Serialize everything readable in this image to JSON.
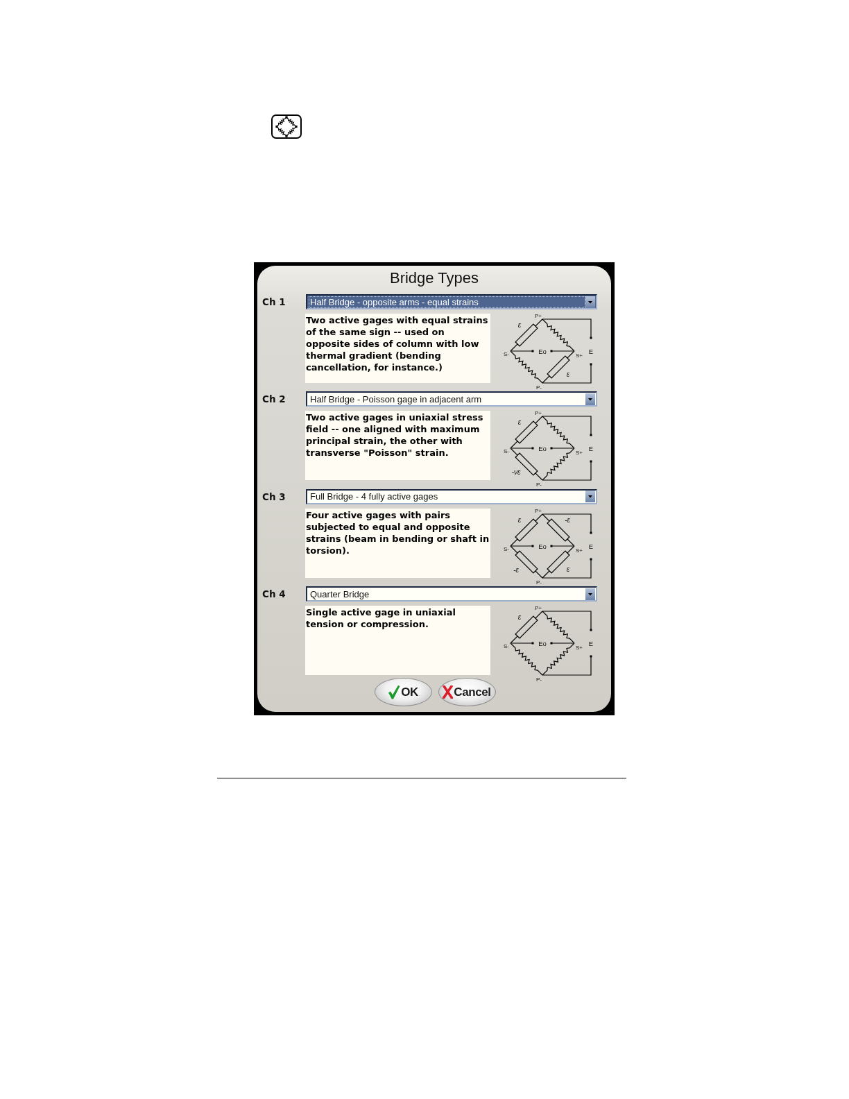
{
  "dialog": {
    "title": "Bridge Types",
    "channels": [
      {
        "label": "Ch 1",
        "bridge_type": "Half Bridge - opposite arms - equal strains",
        "focused": true,
        "description": "Two active gages with equal strains of the same sign -- used on opposite sides of column with low thermal gradient (bending cancellation, for instance.)",
        "diagram": {
          "terminals": {
            "top": "P+",
            "left": "S-",
            "right": "S+",
            "bottom": "P-",
            "output": "Eo",
            "excitation": "E"
          },
          "arms": {
            "upper_left": {
              "kind": "gage",
              "label": "ε"
            },
            "upper_right": {
              "kind": "resistor"
            },
            "lower_left": {
              "kind": "resistor"
            },
            "lower_right": {
              "kind": "gage",
              "label": "ε"
            }
          }
        }
      },
      {
        "label": "Ch 2",
        "bridge_type": "Half Bridge - Poisson gage in adjacent arm",
        "focused": false,
        "description": "Two active gages in uniaxial stress field -- one aligned with maximum principal strain, the other with transverse \"Poisson\" strain.",
        "diagram": {
          "terminals": {
            "top": "P+",
            "left": "S-",
            "right": "S+",
            "bottom": "P-",
            "output": "Eo",
            "excitation": "E"
          },
          "arms": {
            "upper_left": {
              "kind": "gage",
              "label": "ε"
            },
            "upper_right": {
              "kind": "resistor"
            },
            "lower_left": {
              "kind": "gage",
              "label": "-νε"
            },
            "lower_right": {
              "kind": "resistor"
            }
          }
        }
      },
      {
        "label": "Ch 3",
        "bridge_type": "Full Bridge - 4 fully active gages",
        "focused": false,
        "description": "Four active gages with pairs subjected to equal and opposite strains (beam in bending or shaft in torsion).",
        "diagram": {
          "terminals": {
            "top": "P+",
            "left": "S-",
            "right": "S+",
            "bottom": "P-",
            "output": "Eo",
            "excitation": "E"
          },
          "arms": {
            "upper_left": {
              "kind": "gage",
              "label": "ε"
            },
            "upper_right": {
              "kind": "gage",
              "label": "-ε"
            },
            "lower_left": {
              "kind": "gage",
              "label": "-ε"
            },
            "lower_right": {
              "kind": "gage",
              "label": "ε"
            }
          }
        }
      },
      {
        "label": "Ch 4",
        "bridge_type": "Quarter Bridge",
        "focused": false,
        "description": "Single active gage in uniaxial tension or compression.",
        "diagram": {
          "terminals": {
            "top": "P+",
            "left": "S-",
            "right": "S+",
            "bottom": "P-",
            "output": "Eo",
            "excitation": "E"
          },
          "arms": {
            "upper_left": {
              "kind": "gage",
              "label": "ε"
            },
            "upper_right": {
              "kind": "resistor"
            },
            "lower_left": {
              "kind": "resistor"
            },
            "lower_right": {
              "kind": "resistor"
            }
          }
        }
      }
    ],
    "buttons": [
      {
        "kind": "ok",
        "label": "OK"
      },
      {
        "kind": "cancel",
        "label": "Cancel"
      }
    ]
  }
}
